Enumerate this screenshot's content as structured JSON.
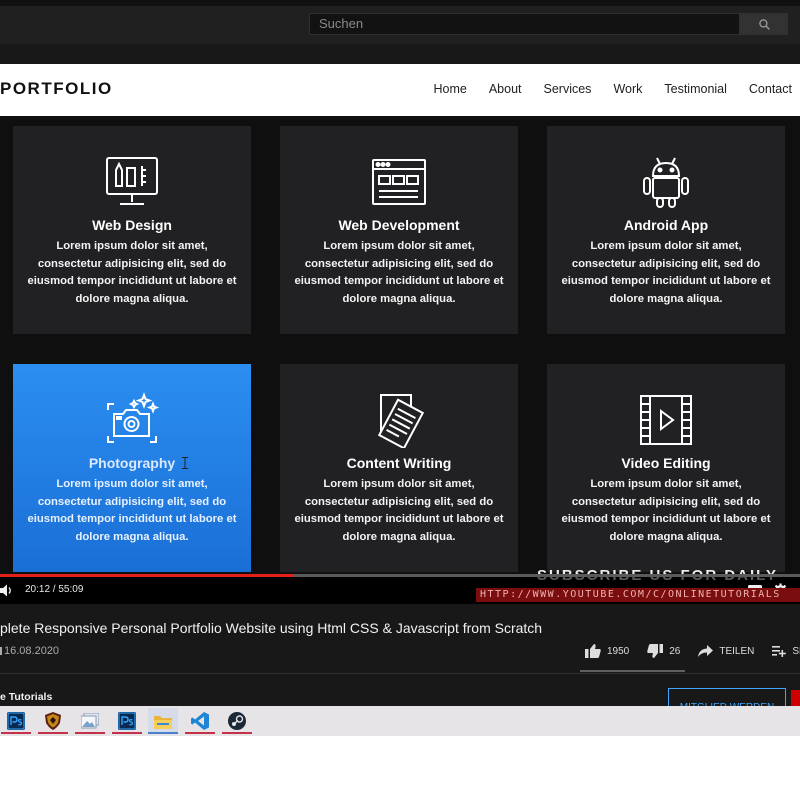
{
  "youtube": {
    "search_placeholder": "Suchen"
  },
  "site": {
    "logo": "PORTFOLIO",
    "nav": [
      "Home",
      "About",
      "Services",
      "Work",
      "Testimonial",
      "Contact"
    ]
  },
  "services": [
    {
      "title": "Web Design",
      "desc": "Lorem ipsum dolor sit amet, consectetur adipisicing elit, sed do eiusmod tempor incididunt ut labore et dolore magna aliqua.",
      "icon": "monitor-design-icon",
      "active": false
    },
    {
      "title": "Web Development",
      "desc": "Lorem ipsum dolor sit amet, consectetur adipisicing elit, sed do eiusmod tempor incididunt ut labore et dolore magna aliqua.",
      "icon": "browser-window-icon",
      "active": false
    },
    {
      "title": "Android App",
      "desc": "Lorem ipsum dolor sit amet, consectetur adipisicing elit, sed do eiusmod tempor incididunt ut labore et dolore magna aliqua.",
      "icon": "android-icon",
      "active": false
    },
    {
      "title": "Photography",
      "desc": "Lorem ipsum dolor sit amet, consectetur adipisicing elit, sed do eiusmod tempor incididunt ut labore et dolore magna aliqua.",
      "icon": "camera-icon",
      "active": true
    },
    {
      "title": "Content Writing",
      "desc": "Lorem ipsum dolor sit amet, consectetur adipisicing elit, sed do eiusmod tempor incididunt ut labore et dolore magna aliqua.",
      "icon": "documents-icon",
      "active": false
    },
    {
      "title": "Video Editing",
      "desc": "Lorem ipsum dolor sit amet, consectetur adipisicing elit, sed do eiusmod tempor incididunt ut labore et dolore magna aliqua.",
      "icon": "film-play-icon",
      "active": false
    }
  ],
  "player": {
    "time": "20:12 / 55:09",
    "progress_fraction": 0.366,
    "subscribe_banner": "SUBSCRIBE US FOR DAILY",
    "url_banner": "HTTP://WWW.YOUTUBE.COM/C/ONLINETUTORIALS"
  },
  "video_info": {
    "title": "plete Responsive Personal Portfolio Website using Html CSS & Javascript from Scratch",
    "date": "16.08.2020",
    "likes": "1950",
    "dislikes": "26",
    "share_label": "TEILEN",
    "save_label": "SP",
    "channel": "e Tutorials",
    "join_label": "MITGLIED WERDEN"
  },
  "taskbar": {
    "apps": [
      "photoshop-icon",
      "shield-game-icon",
      "photos-icon",
      "photoshop-icon",
      "file-explorer-icon",
      "vscode-icon",
      "steam-icon"
    ]
  },
  "colors": {
    "accent_blue": "#2b8ef0",
    "progress_red": "#e52018",
    "card_bg": "#212124"
  }
}
